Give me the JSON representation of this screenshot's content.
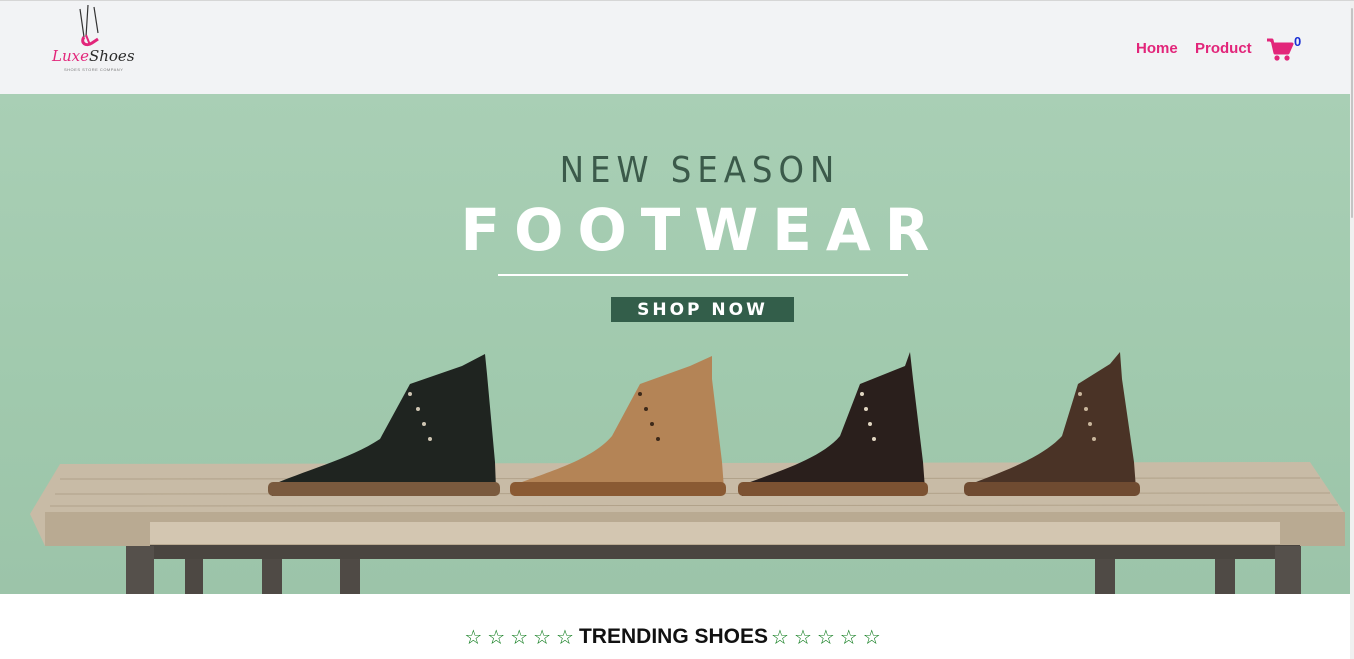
{
  "brand": {
    "logo_text_part1": "Luxe",
    "logo_text_part2": "Shoes",
    "tagline": "SHOES STORE COMPANY"
  },
  "nav": {
    "home_label": "Home",
    "product_label": "Product",
    "cart_count": "0",
    "cart_icon": "shopping-cart-icon"
  },
  "hero": {
    "kicker": "NEW SEASON",
    "title": "FOOTWEAR",
    "cta_label": "SHOP NOW"
  },
  "trending": {
    "stars_left": "☆☆☆☆☆",
    "title": "TRENDING SHOES",
    "stars_right": "☆☆☆☆☆"
  },
  "colors": {
    "accent": "#e2257a",
    "cart_count": "#1a2fd4",
    "hero_bg": "#a9cfb5",
    "cta_bg": "#335e4a",
    "star": "#0b7a19"
  }
}
